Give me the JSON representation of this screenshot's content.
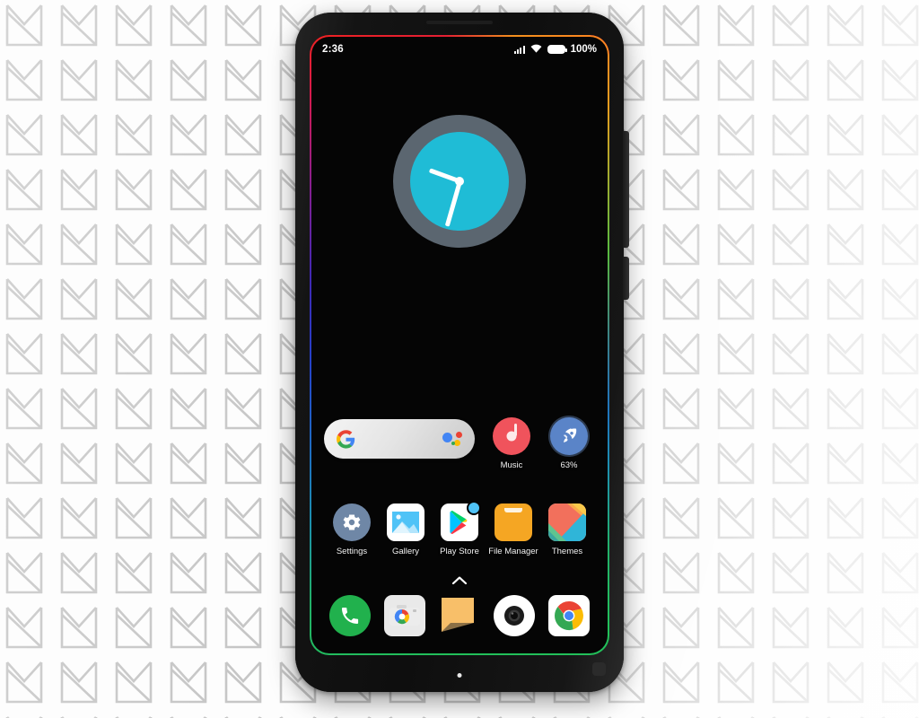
{
  "wallpaper": {
    "pattern_name": "mi-logo-tile",
    "pattern_color": "#c6c6c6",
    "background_color": "#fdfdfd"
  },
  "device": {
    "name": "Xiaomi Mi Mix 2 phone mockup",
    "body_color": "#131313",
    "screen_background": "#050505",
    "edge_light_colors": [
      "#ef2222",
      "#8a1f8f",
      "#2640c9",
      "#22c05a",
      "#ff8a1f"
    ],
    "buttons": {
      "volume": "volume-rocker",
      "power": "power-button"
    }
  },
  "status_bar": {
    "time": "2:36",
    "battery_percent": "100%",
    "icons": [
      "signal-icon",
      "wifi-icon",
      "battery-icon"
    ]
  },
  "clock_widget": {
    "name": "analog-clock-widget",
    "ring_color": "#5b6670",
    "face_color": "#1fbcd6",
    "hand_color": "#ffffff",
    "hour_angle_deg": 290,
    "minute_angle_deg": 196,
    "displays_time": "2:36"
  },
  "search": {
    "name": "google-search-bar",
    "placeholder": "",
    "value": "",
    "left_icon": "google-g-icon",
    "right_icon": "google-assistant-icon"
  },
  "home_row": [
    {
      "label": "Music",
      "icon": "music-note-icon",
      "color": "#f0535c"
    },
    {
      "label": "63%",
      "icon": "rocket-booster-icon",
      "color": "#5a84c8"
    }
  ],
  "app_grid": [
    {
      "label": "Settings",
      "icon": "gear-icon"
    },
    {
      "label": "Gallery",
      "icon": "photo-icon"
    },
    {
      "label": "Play Store",
      "icon": "play-store-icon",
      "badge": true
    },
    {
      "label": "File Manager",
      "icon": "folder-icon"
    },
    {
      "label": "Themes",
      "icon": "themes-icon"
    }
  ],
  "drawer": {
    "arrow_icon": "chevron-up-icon",
    "hint": ""
  },
  "dock": [
    {
      "label": "Phone",
      "icon": "phone-icon"
    },
    {
      "label": "Camera",
      "icon": "camera-icon"
    },
    {
      "label": "Messages",
      "icon": "message-bubble-icon"
    },
    {
      "label": "Lens",
      "icon": "camera-lens-icon"
    },
    {
      "label": "Chrome",
      "icon": "chrome-icon"
    }
  ]
}
